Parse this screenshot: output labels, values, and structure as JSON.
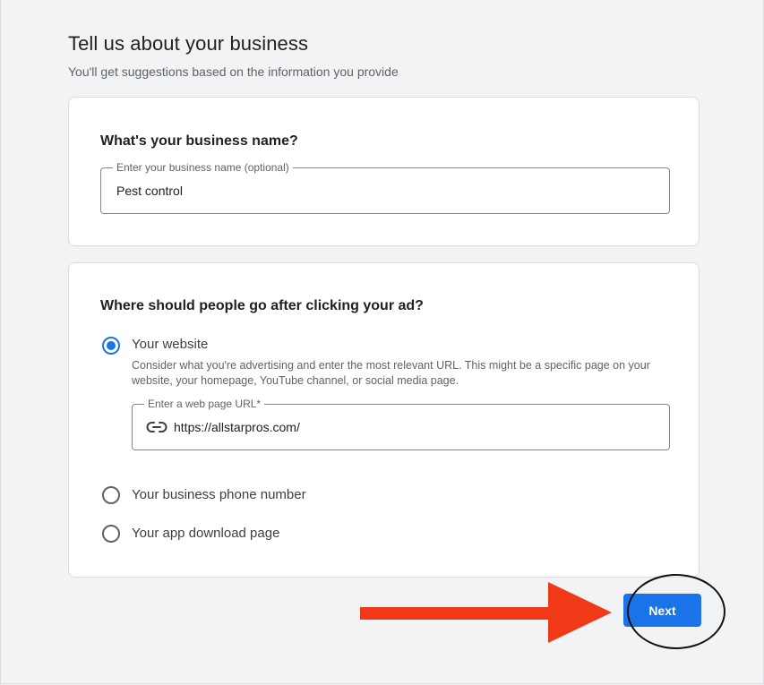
{
  "header": {
    "title": "Tell us about your business",
    "subtitle": "You'll get suggestions based on the information you provide"
  },
  "business_name": {
    "heading": "What's your business name?",
    "field_label": "Enter your business name (optional)",
    "value": "Pest control"
  },
  "destination": {
    "heading": "Where should people go after clicking your ad?",
    "options": [
      {
        "label": "Your website",
        "selected": true,
        "description": "Consider what you're advertising and enter the most relevant URL. This might be a specific page on your website, your homepage, YouTube channel, or social media page."
      },
      {
        "label": "Your business phone number",
        "selected": false
      },
      {
        "label": "Your app download page",
        "selected": false
      }
    ],
    "url_field": {
      "label": "Enter a web page URL*",
      "value": "https://allstarpros.com/",
      "icon": "link-icon"
    }
  },
  "footer": {
    "next_label": "Next"
  },
  "colors": {
    "accent": "#1a73e8",
    "annotation_arrow": "#f03a17",
    "background": "#f1f3f4"
  }
}
